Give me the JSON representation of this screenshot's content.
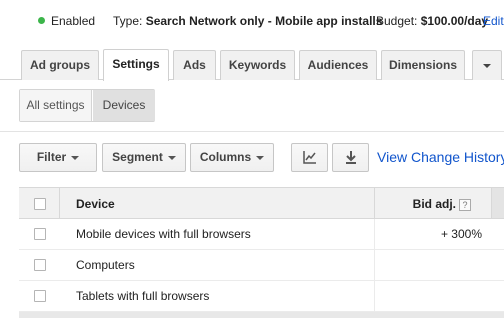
{
  "status": {
    "state": "Enabled",
    "type_label": "Type:",
    "type_value": "Search Network only - Mobile app installs",
    "budget_label": "Budget:",
    "budget_value": "$100.00/day",
    "edit_label": "Edit",
    "state_color": "#3cb54a"
  },
  "tabs": [
    "Ad groups",
    "Settings",
    "Ads",
    "Keywords",
    "Audiences",
    "Dimensions"
  ],
  "active_tab": "Settings",
  "subtabs": {
    "all": "All settings",
    "devices": "Devices",
    "active": "Devices"
  },
  "toolbar": {
    "filter": "Filter",
    "segment": "Segment",
    "columns": "Columns",
    "chart_icon": "line-chart-icon",
    "download_icon": "download-icon",
    "history_link": "View Change History"
  },
  "table": {
    "headers": {
      "device": "Device",
      "bid": "Bid adj.",
      "help": "?"
    },
    "rows": [
      {
        "device": "Mobile devices with full browsers",
        "bid": "+ 300%"
      },
      {
        "device": "Computers",
        "bid": ""
      },
      {
        "device": "Tablets with full browsers",
        "bid": ""
      }
    ]
  },
  "colors": {
    "link": "#1155cc",
    "accent_green": "#3cb54a"
  }
}
